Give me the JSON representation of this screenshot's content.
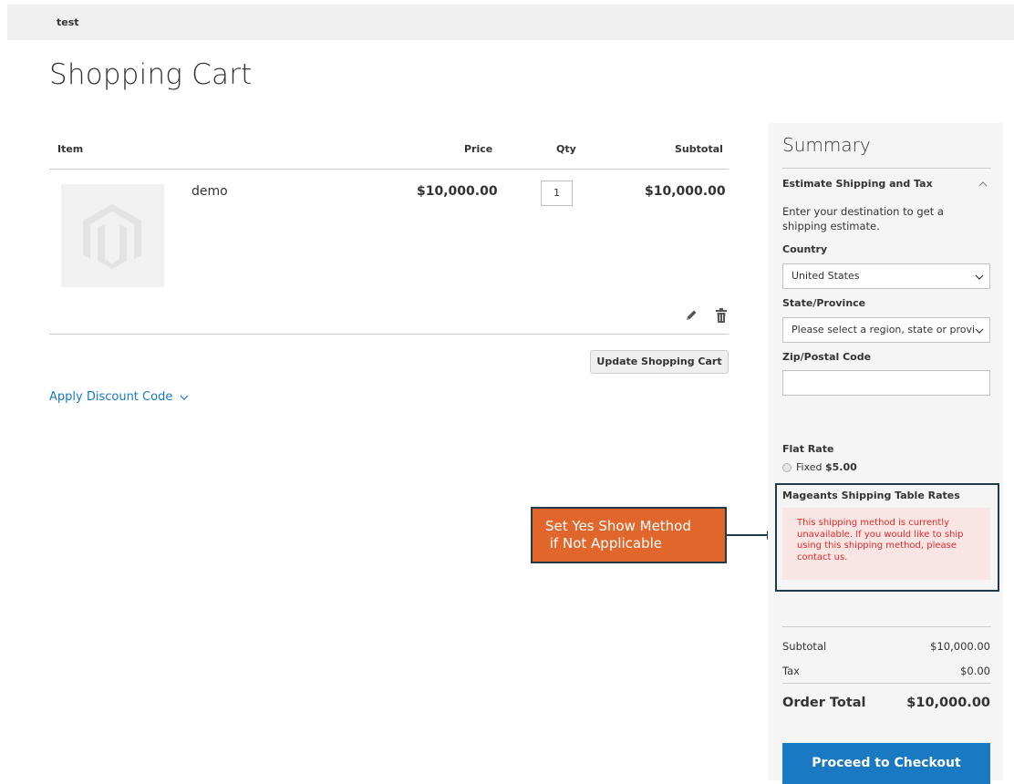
{
  "header": {
    "store_name": "test"
  },
  "page": {
    "title": "Shopping Cart"
  },
  "cart": {
    "columns": {
      "item": "Item",
      "price": "Price",
      "qty": "Qty",
      "subtotal": "Subtotal"
    },
    "items": [
      {
        "name": "demo",
        "price": "$10,000.00",
        "qty": "1",
        "subtotal": "$10,000.00",
        "thumbnail_icon": "magento-logo-icon"
      }
    ],
    "update_button": "Update Shopping Cart",
    "discount_link": "Apply Discount Code"
  },
  "callout": {
    "line1": "Set Yes Show Method",
    "line2": " if Not Applicable"
  },
  "summary": {
    "title": "Summary",
    "estimate_title": "Estimate Shipping and Tax",
    "estimate_desc": "Enter your destination to get a shipping estimate.",
    "country_label": "Country",
    "country_value": "United States",
    "state_label": "State/Province",
    "state_value": "Please select a region, state or province.",
    "zip_label": "Zip/Postal Code",
    "zip_value": "",
    "flat_rate_title": "Flat Rate",
    "flat_rate_option": "Fixed",
    "flat_rate_price": "$5.00",
    "mageants_title": "Mageants Shipping Table Rates",
    "mageants_error": "This shipping method is currently unavailable. If you would like to ship using this shipping method, please contact us.",
    "subtotal_label": "Subtotal",
    "subtotal_value": "$10,000.00",
    "tax_label": "Tax",
    "tax_value": "$0.00",
    "order_total_label": "Order Total",
    "order_total_value": "$10,000.00",
    "checkout_button": "Proceed to Checkout"
  },
  "colors": {
    "link": "#1979c3",
    "checkout_button": "#1979c3",
    "error_text": "#e02b27",
    "error_bg": "#fae5e5",
    "callout_bg": "#e0662b",
    "callout_border": "#1f3b4a"
  }
}
